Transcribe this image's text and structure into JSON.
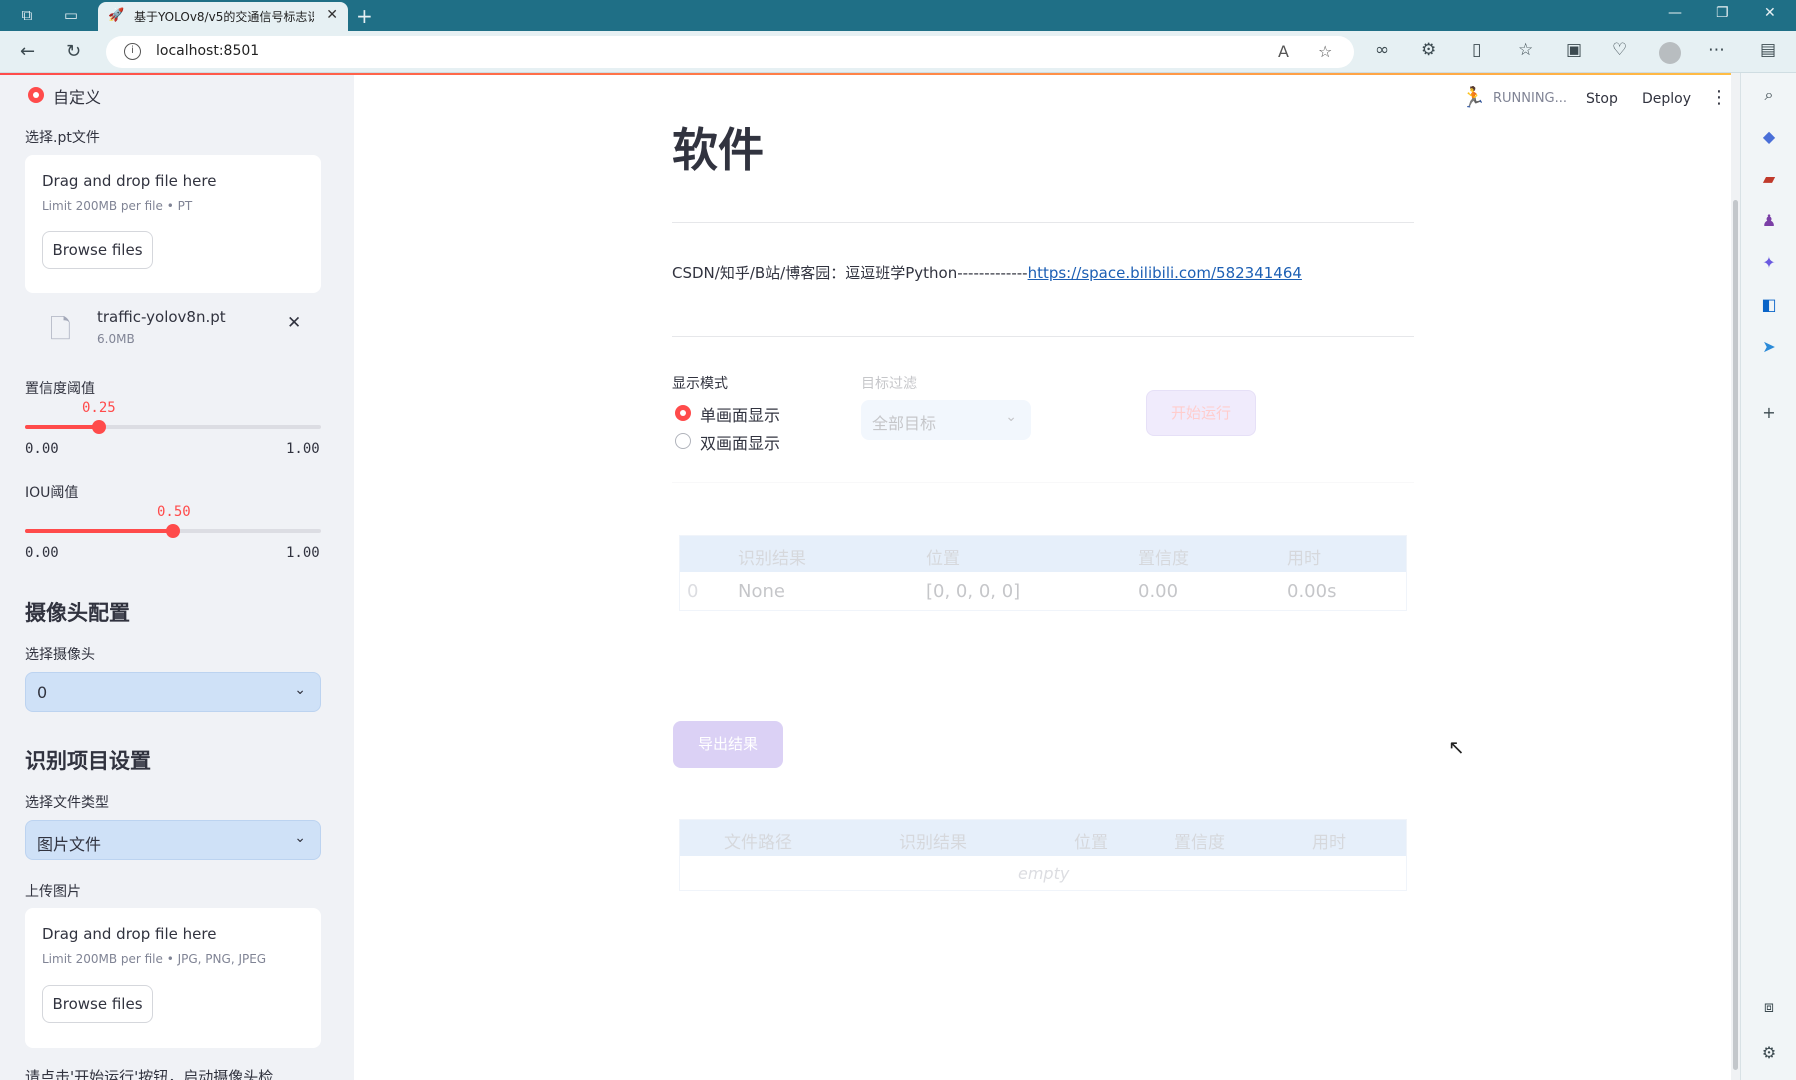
{
  "browser": {
    "tab_title": "基于YOLOv8/v5的交通信号标志识",
    "url": "localhost:8501"
  },
  "header": {
    "status": "RUNNING...",
    "stop": "Stop",
    "deploy": "Deploy"
  },
  "sidebar": {
    "model_option": "自定义",
    "pt_label": "选择.pt文件",
    "pt_drop": {
      "title": "Drag and drop file here",
      "limit": "Limit 200MB per file • PT",
      "button": "Browse files"
    },
    "uploaded_file": {
      "name": "traffic-yolov8n.pt",
      "size": "6.0MB"
    },
    "conf": {
      "label": "置信度阈值",
      "value": "0.25",
      "min": "0.00",
      "max": "1.00",
      "fraction": 0.25
    },
    "iou": {
      "label": "IOU阈值",
      "value": "0.50",
      "min": "0.00",
      "max": "1.00",
      "fraction": 0.5
    },
    "camera_header": "摄像头配置",
    "camera_label": "选择摄像头",
    "camera_value": "0",
    "task_header": "识别项目设置",
    "filetype_label": "选择文件类型",
    "filetype_value": "图片文件",
    "upload_label": "上传图片",
    "img_drop": {
      "title": "Drag and drop file here",
      "limit": "Limit 200MB per file • JPG, PNG, JPEG",
      "button": "Browse files"
    },
    "hint": "请点击'开始运行'按钮，启动摄像头检"
  },
  "main": {
    "title": "软件",
    "credit_text": "CSDN/知乎/B站/博客园：逗逗班学Python-------------",
    "credit_link": "https://space.bilibili.com/582341464",
    "display_mode_label": "显示模式",
    "display_modes": [
      "单画面显示",
      "双画面显示"
    ],
    "filter_label": "目标过滤",
    "filter_value": "全部目标",
    "run_button": "开始运行",
    "result_table": {
      "headers": [
        "识别结果",
        "位置",
        "置信度",
        "用时"
      ],
      "row": {
        "index": "0",
        "label": "None",
        "position": "[0, 0, 0, 0]",
        "confidence": "0.00",
        "time": "0.00s"
      }
    },
    "export_button": "导出结果",
    "log_table": {
      "headers": [
        "文件路径",
        "识别结果",
        "位置",
        "置信度",
        "用时"
      ],
      "empty": "empty"
    }
  },
  "colors": {
    "accent": "#ff4b4b",
    "sidebar_bg": "#f0f2f6",
    "titlebar": "#1f6f86"
  }
}
